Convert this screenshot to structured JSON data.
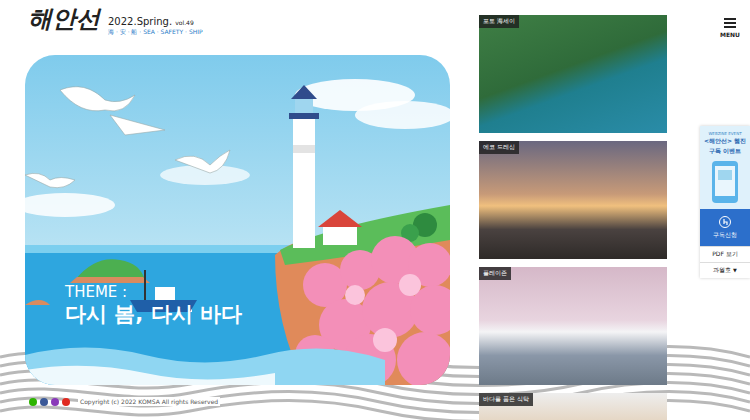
{
  "logo": {
    "text": "해안선",
    "issue": "2022.Spring.",
    "volume": "vol.49",
    "tagline": "海 · 安 · 船 · SEA · SAFETY · SHIP"
  },
  "hero": {
    "theme_label": "THEME :",
    "theme_title": "다시 봄, 다시 바다"
  },
  "articles": [
    {
      "label": "포토 海세이"
    },
    {
      "label": "에코 드레싱"
    },
    {
      "label": "플레이존"
    },
    {
      "label": "바다를 품은 식탁"
    }
  ],
  "menu": {
    "label": "MENU"
  },
  "side_banner": {
    "eyebrow": "WEBZINE EVENT",
    "title": "<해안선> 웹진",
    "subtitle": "구독 이벤트",
    "button": "구독신청",
    "pdf": "PDF 보기",
    "archive": "과월호",
    "archive_icon": "▼"
  },
  "footer": {
    "copyright": "Copyright (c) 2022 KOMSA All rights Reserved",
    "social": [
      {
        "color": "#2db400"
      },
      {
        "color": "#3b5998"
      },
      {
        "color": "#8a3ab9"
      },
      {
        "color": "#e02a20"
      }
    ]
  }
}
